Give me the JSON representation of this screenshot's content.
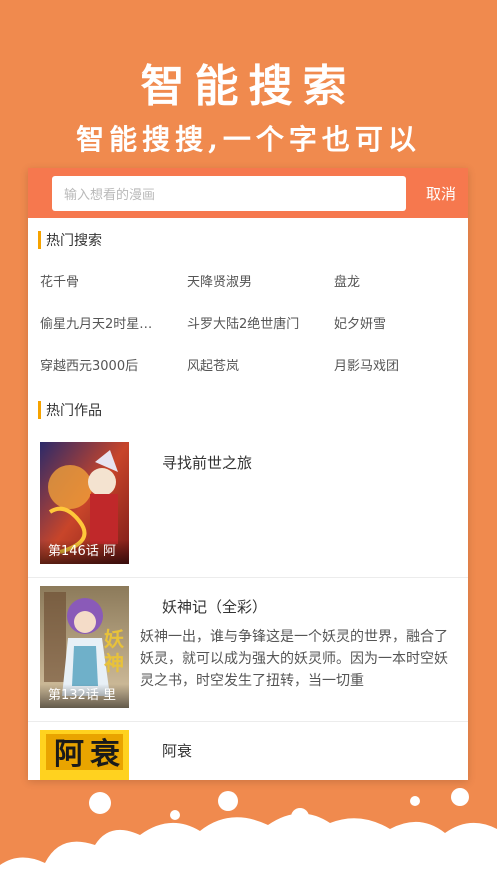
{
  "hero": {
    "title": "智能搜索",
    "subtitle": "智能搜搜,一个字也可以"
  },
  "search": {
    "placeholder": "输入想看的漫画",
    "cancel_label": "取消"
  },
  "hot_search": {
    "heading": "热门搜索",
    "items": [
      "花千骨",
      "天降贤淑男",
      "盘龙",
      "偷星九月天2时星…",
      "斗罗大陆2绝世唐门",
      "妃夕妍雪",
      "穿越西元3000后",
      "风起苍岚",
      "月影马戏团"
    ]
  },
  "hot_works": {
    "heading": "热门作品",
    "items": [
      {
        "title": "寻找前世之旅",
        "chapter": "第146话 阿",
        "description": ""
      },
      {
        "title": "妖神记（全彩）",
        "chapter": "第132话 里",
        "description": "妖神一出，谁与争锋这是一个妖灵的世界，融合了妖灵，就可以成为强大的妖灵师。因为一本时空妖灵之书，时空发生了扭转，当一切重"
      },
      {
        "title": "阿衰",
        "chapter": "",
        "description": ""
      }
    ]
  },
  "colors": {
    "background": "#F08A4E",
    "search_bar": "#F6784E",
    "section_accent": "#F6A300"
  }
}
